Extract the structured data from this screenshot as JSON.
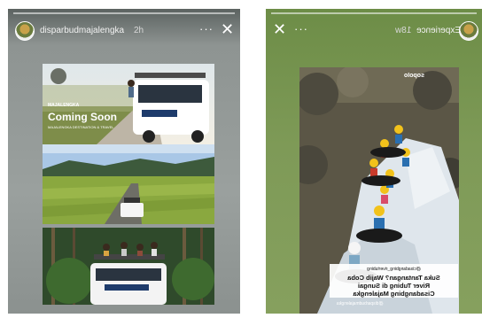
{
  "left_story": {
    "username": "disparbudmajalengka",
    "time": "2h",
    "more_icon": "ellipsis-icon",
    "close_icon": "close-icon",
    "panel1": {
      "brand": "MAJALENGKA",
      "headline": "Coming Soon",
      "subtext": "MAJALENGKA DESTINATION & TRAVEL"
    }
  },
  "right_story": {
    "username": "Experience",
    "time": "18w",
    "more_icon": "ellipsis-icon",
    "close_icon": "close-icon",
    "mention": "sopolo",
    "caption": {
      "tag": "@cisadangbing_rivertubing",
      "lines": [
        "Suka Tantangan? Wajib Coba",
        "River Tubing di Sungai",
        "Cisadangbing Majalengka"
      ],
      "handle": "@disparbudmajalengka"
    }
  }
}
